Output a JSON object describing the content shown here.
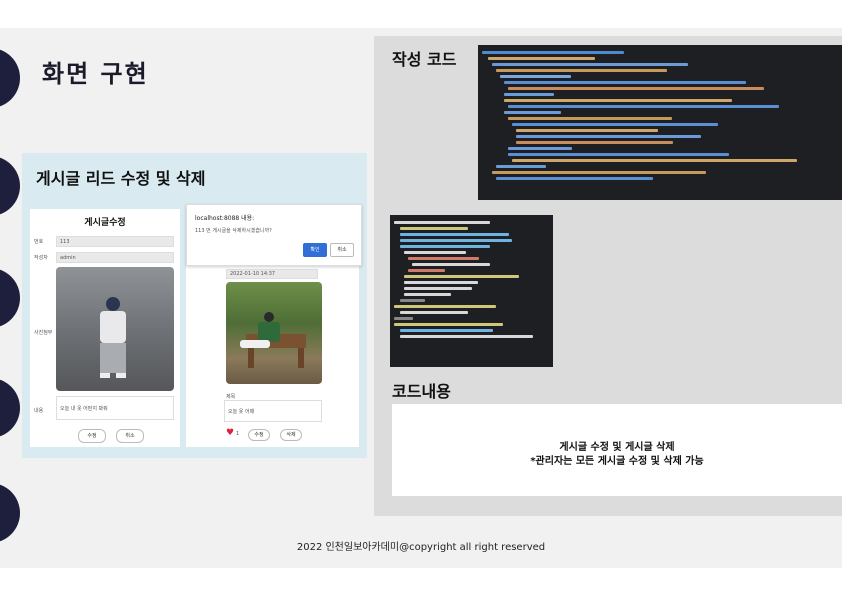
{
  "slide": {
    "title": "화면 구현",
    "footer": "2022 인천일보아카데미@copyright all right reserved"
  },
  "left": {
    "heading": "게시글 리드 수정 및 삭제",
    "edit_form": {
      "title": "게시글수정",
      "labels": [
        "번호",
        "작성자",
        "사진첨부",
        "내용"
      ],
      "values": [
        "113",
        "admin"
      ],
      "submit": "수정",
      "cancel": "취소",
      "content_value": "오늘 내 옷 어떤지 봐줘"
    },
    "detail_view": {
      "date": "2022-01-10 14:37",
      "caption_title": "제목",
      "caption_text": "오늘 옷 어때",
      "like_count": "1",
      "edit_btn": "수정",
      "delete_btn": "삭제"
    },
    "dialog": {
      "host": "localhost:8088 내용:",
      "message": "113 번 게시글을 삭제하시겠습니까?",
      "ok": "확인",
      "cancel": "취소"
    }
  },
  "right": {
    "code_label": "작성 코드",
    "content_label": "코드내용",
    "content_lines": [
      "게시글 수정 및 게시글 삭제",
      "*관리자는 모든 게시글 수정 및 삭제 가능"
    ]
  },
  "colors": {
    "accent": "#1d1f3c",
    "panel": "#d9ebf1",
    "code_bg": "#1e1f22",
    "primary_btn": "#2f6fd6"
  }
}
